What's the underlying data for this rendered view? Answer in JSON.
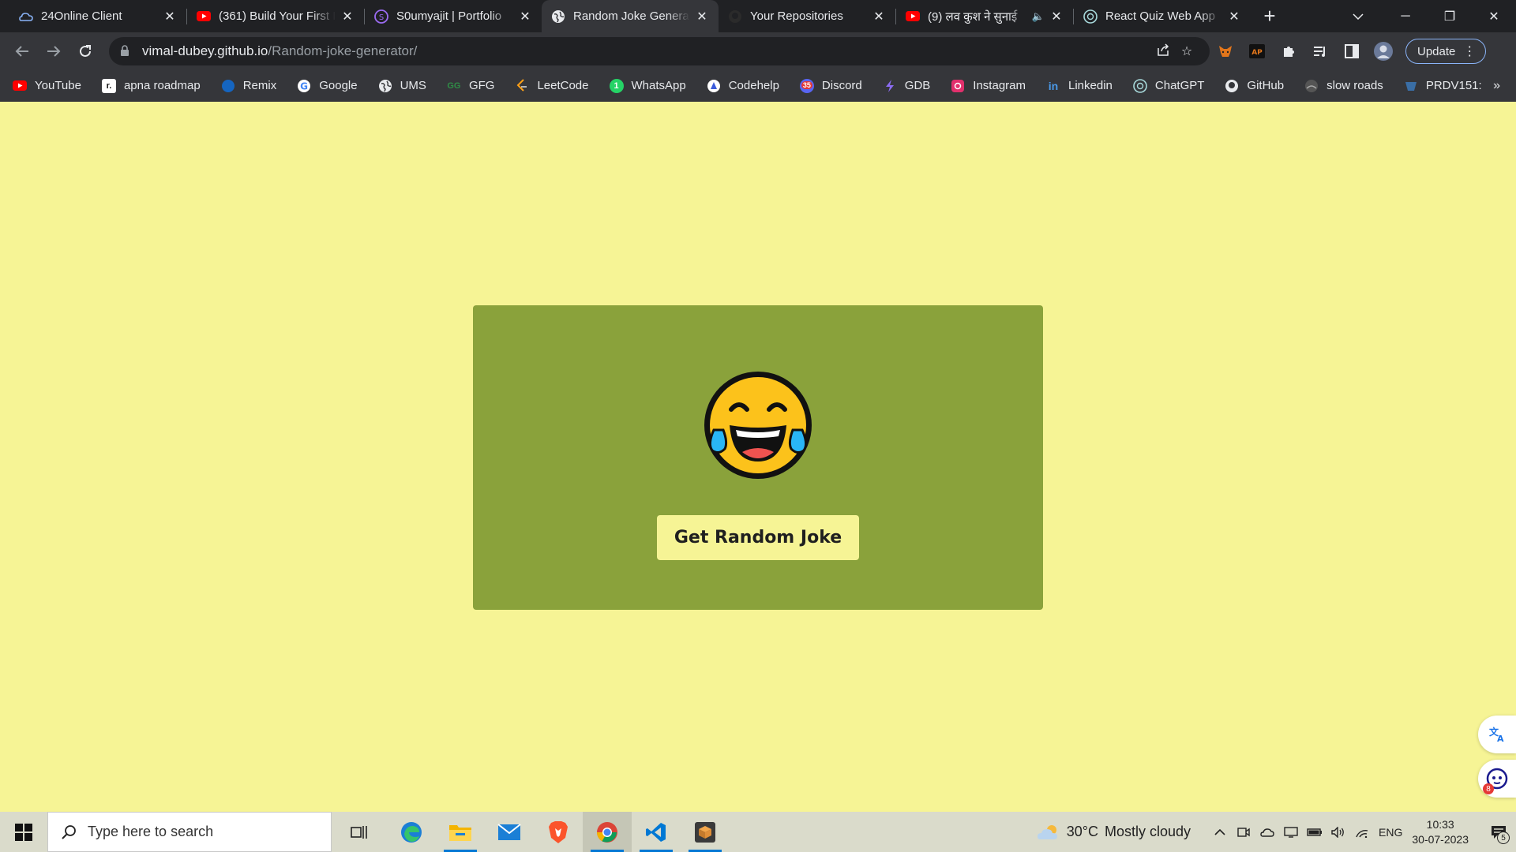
{
  "browser": {
    "tabs": [
      {
        "title": "24Online Client",
        "icon": "cloud-icon",
        "active": false
      },
      {
        "title": "(361) Build Your First I",
        "icon": "youtube-icon",
        "active": false
      },
      {
        "title": "S0umyajit | Portfolio",
        "icon": "portfolio-icon",
        "active": false
      },
      {
        "title": "Random Joke Generat",
        "icon": "globe-icon",
        "active": true
      },
      {
        "title": "Your Repositories",
        "icon": "github-icon",
        "active": false
      },
      {
        "title": "(9) लव कुश ने सुनाई",
        "icon": "youtube-icon",
        "active": false,
        "audio": true
      },
      {
        "title": "React Quiz Web App",
        "icon": "chatgpt-icon",
        "active": false
      }
    ],
    "url_host": "vimal-dubey.github.io",
    "url_path": "/Random-joke-generator/",
    "update_label": "Update",
    "bookmarks": [
      {
        "label": "YouTube",
        "icon": "youtube-icon",
        "color": "#ff0000"
      },
      {
        "label": "apna roadmap",
        "icon": "roadmap-icon",
        "color": "#111111"
      },
      {
        "label": "Remix",
        "icon": "remix-icon",
        "color": "#1565c0"
      },
      {
        "label": "Google",
        "icon": "google-icon",
        "color": "#4285f4"
      },
      {
        "label": "UMS",
        "icon": "globe-icon",
        "color": "#5f6368"
      },
      {
        "label": "GFG",
        "icon": "gfg-icon",
        "color": "#2f8d46"
      },
      {
        "label": "LeetCode",
        "icon": "leetcode-icon",
        "color": "#ffa116"
      },
      {
        "label": "WhatsApp",
        "icon": "whatsapp-icon",
        "color": "#25d366"
      },
      {
        "label": "Codehelp",
        "icon": "codehelp-icon",
        "color": "#3b5bdb"
      },
      {
        "label": "Discord",
        "icon": "discord-icon",
        "color": "#5865f2"
      },
      {
        "label": "GDB",
        "icon": "gdb-icon",
        "color": "#6a3de8"
      },
      {
        "label": "Instagram",
        "icon": "instagram-icon",
        "color": "#e1306c"
      },
      {
        "label": "Linkedin",
        "icon": "linkedin-icon",
        "color": "#0a66c2"
      },
      {
        "label": "ChatGPT",
        "icon": "chatgpt-icon",
        "color": "#10a37f"
      },
      {
        "label": "GitHub",
        "icon": "github-icon",
        "color": "#24292f"
      },
      {
        "label": "slow roads",
        "icon": "slowroads-icon",
        "color": "#444444"
      },
      {
        "label": "PRDV151:",
        "icon": "prdv-icon",
        "color": "#3a6ea5"
      }
    ],
    "discord_badge": "35"
  },
  "page": {
    "background": "#f6f495",
    "card_color": "#8aa23b",
    "emoji": "face-with-tears-of-joy",
    "button_label": "Get Random Joke",
    "bot_badge": "8"
  },
  "taskbar": {
    "search_placeholder": "Type here to search",
    "temperature": "30°C",
    "weather": "Mostly cloudy",
    "language": "ENG",
    "time": "10:33",
    "date": "30-07-2023",
    "notifications": "5"
  }
}
